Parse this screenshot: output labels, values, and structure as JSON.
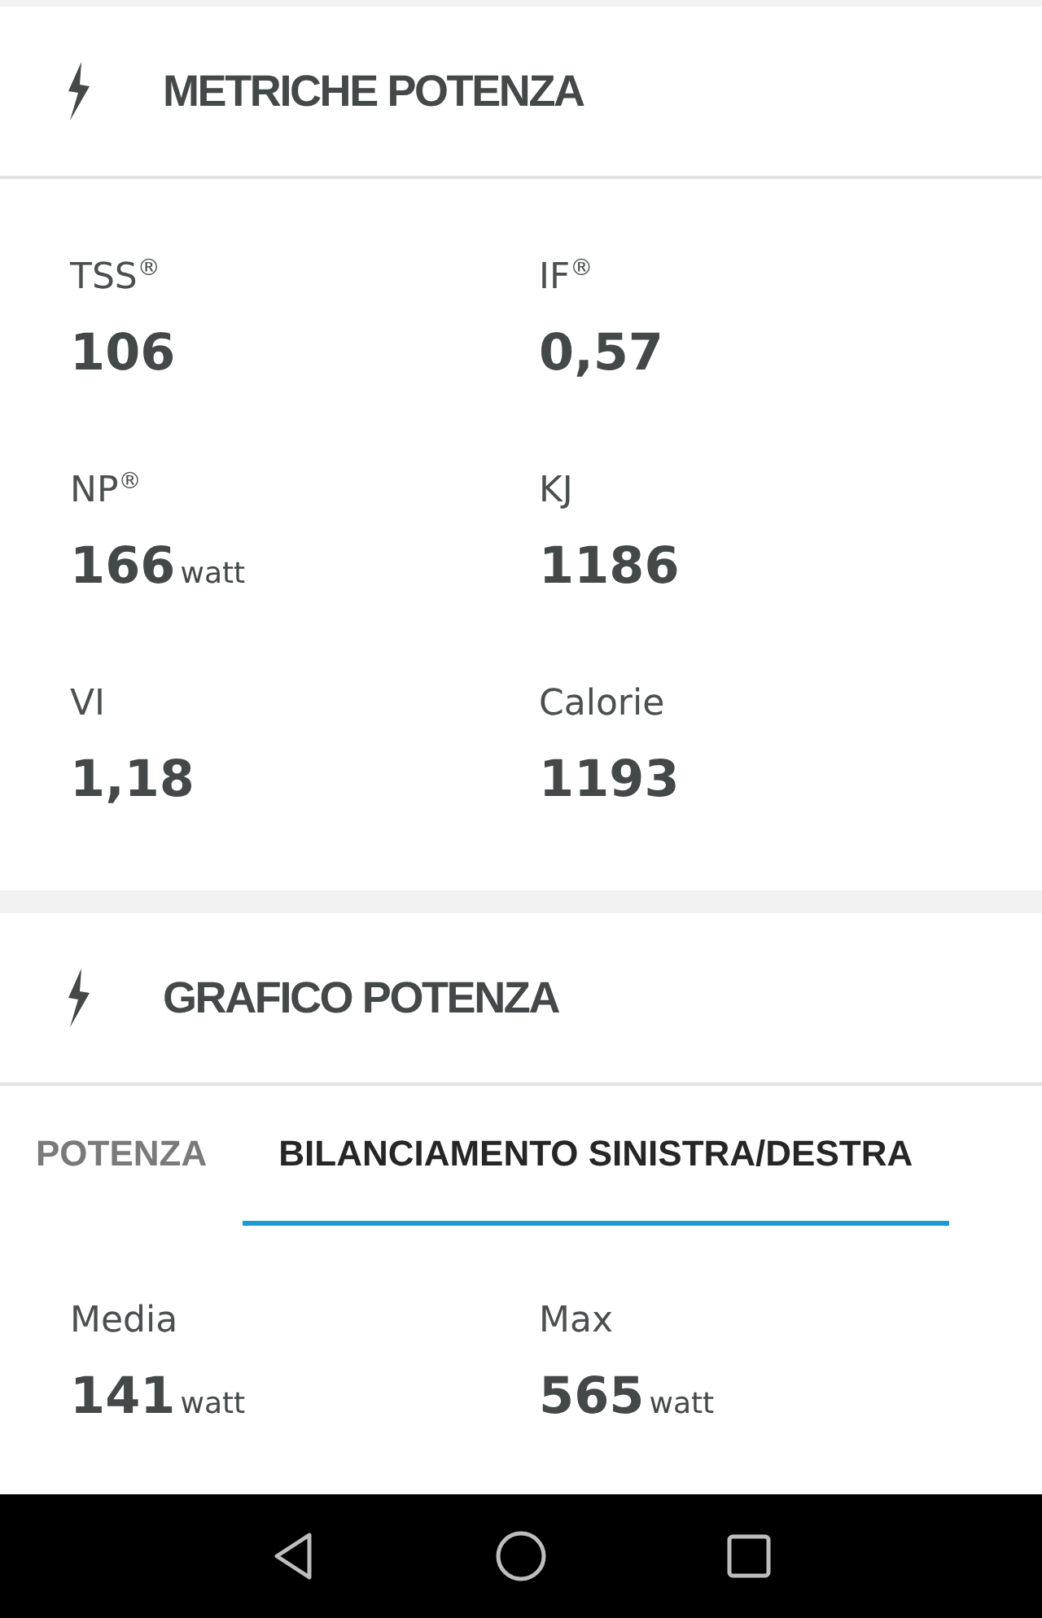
{
  "power_metrics": {
    "title": "METRICHE POTENZA",
    "metrics": [
      {
        "label": "TSS$^{®}$",
        "value": "106"
      },
      {
        "label": "IF$^{®}$",
        "value": "0,57"
      },
      {
        "label": "NP$^{®}$",
        "value": "166",
        "unit": "watt"
      },
      {
        "label": "KJ",
        "value": "1186"
      },
      {
        "label": "VI",
        "value": "1,18"
      },
      {
        "label": "Calorie",
        "value": "1193"
      }
    ]
  },
  "power_chart": {
    "title": "GRAFICO POTENZA",
    "tabs": [
      {
        "label": "POTENZA",
        "selected": false
      },
      {
        "label": "BILANCIAMENTO SINISTRA/DESTRA",
        "selected": true
      }
    ],
    "stats": [
      {
        "label": "Media",
        "value": "141",
        "unit": "watt"
      },
      {
        "label": "Max",
        "value": "565",
        "unit": "watt"
      }
    ]
  }
}
